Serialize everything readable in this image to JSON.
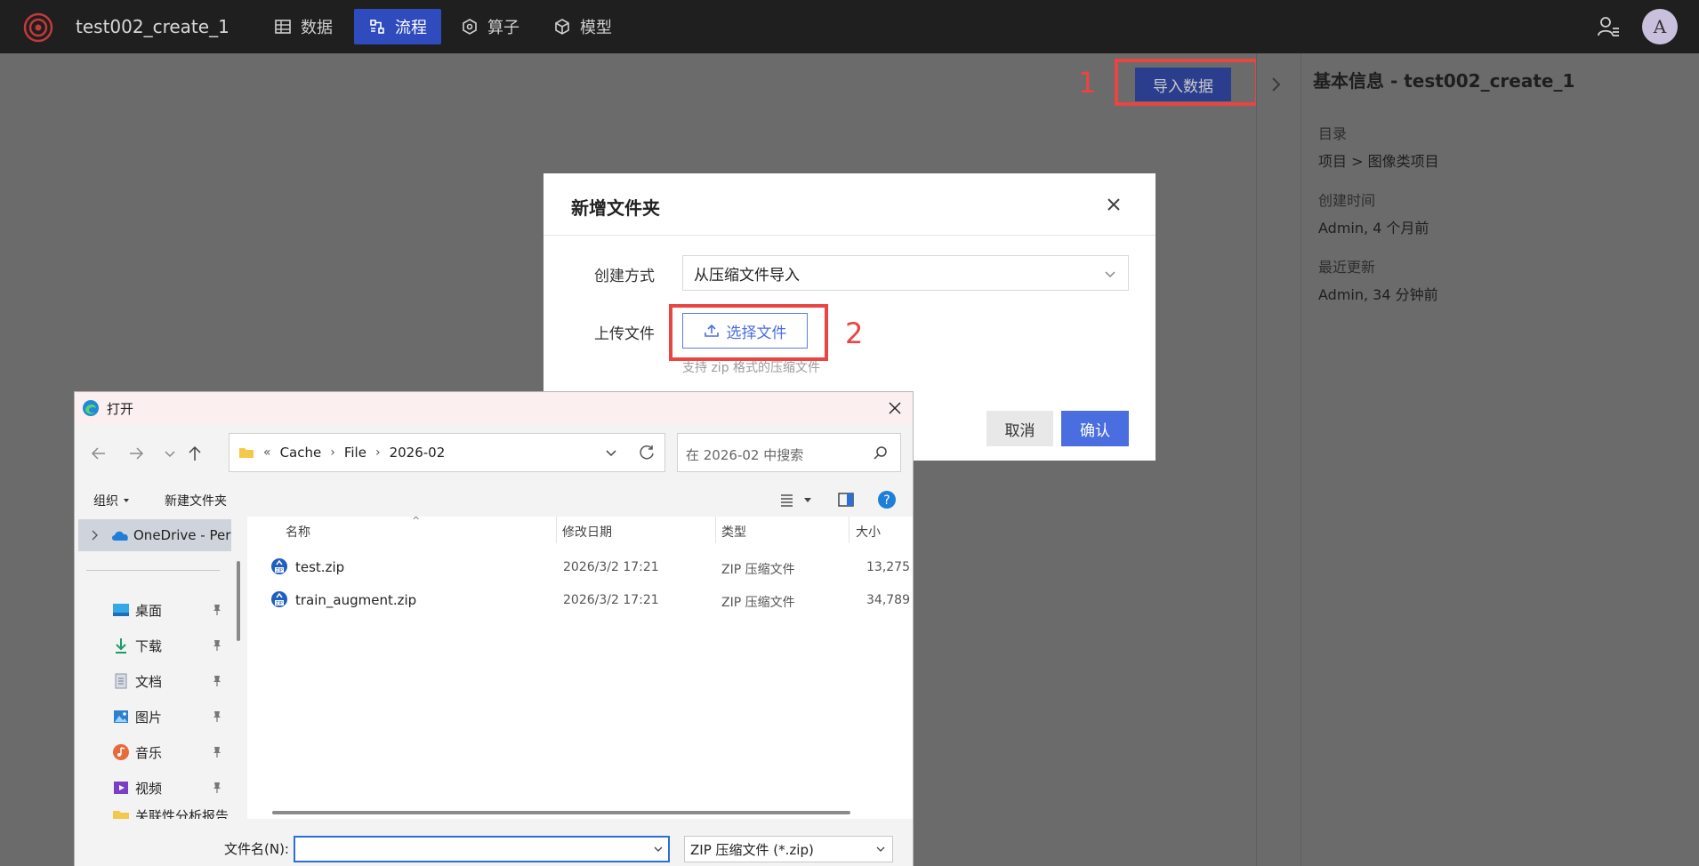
{
  "app": {
    "title": "test002_create_1",
    "nav": [
      {
        "label": "数据",
        "icon": "table-icon"
      },
      {
        "label": "流程",
        "icon": "flow-icon"
      },
      {
        "label": "算子",
        "icon": "operator-icon"
      },
      {
        "label": "模型",
        "icon": "cube-icon"
      }
    ],
    "avatar_letter": "A",
    "active_color": "#2f4bbd"
  },
  "main": {
    "import_button": "导入数据",
    "annotation_1": "1",
    "annotation_2": "2",
    "highlight_color": "#e94542"
  },
  "right_panel": {
    "title": "基本信息 - test002_create_1",
    "fields": [
      {
        "label": "目录",
        "value": "项目 > 图像类项目"
      },
      {
        "label": "创建时间",
        "value": "Admin, 4 个月前"
      },
      {
        "label": "最近更新",
        "value": "Admin, 34 分钟前"
      }
    ]
  },
  "dialog": {
    "title": "新增文件夹",
    "create_method_label": "创建方式",
    "create_method_value": "从压缩文件导入",
    "upload_label": "上传文件",
    "upload_button": "选择文件",
    "upload_hint": "支持 zip 格式的压缩文件",
    "cancel": "取消",
    "confirm": "确认"
  },
  "file_dialog": {
    "title": "打开",
    "path": [
      "Cache",
      "File",
      "2026-02"
    ],
    "path_prefix": "«",
    "search_placeholder": "在 2026-02 中搜索",
    "toolbar": {
      "organize": "组织",
      "new_folder": "新建文件夹"
    },
    "onedrive": "OneDrive - Per",
    "sidebar": [
      {
        "label": "桌面",
        "icon": "desktop-icon"
      },
      {
        "label": "下载",
        "icon": "download-icon"
      },
      {
        "label": "文档",
        "icon": "document-icon"
      },
      {
        "label": "图片",
        "icon": "pictures-icon"
      },
      {
        "label": "音乐",
        "icon": "music-icon"
      },
      {
        "label": "视频",
        "icon": "video-icon"
      },
      {
        "label": "关联性分析报告",
        "icon": "folder-icon"
      }
    ],
    "columns": {
      "name": "名称",
      "date": "修改日期",
      "type": "类型",
      "size": "大小"
    },
    "files": [
      {
        "name": "test.zip",
        "date": "2026/3/2 17:21",
        "type": "ZIP 压缩文件",
        "size": "13,275"
      },
      {
        "name": "train_augment.zip",
        "date": "2026/3/2 17:21",
        "type": "ZIP 压缩文件",
        "size": "34,789"
      }
    ],
    "filename_label": "文件名(N):",
    "filename_value": "",
    "filetype": "ZIP 压缩文件 (*.zip)"
  }
}
